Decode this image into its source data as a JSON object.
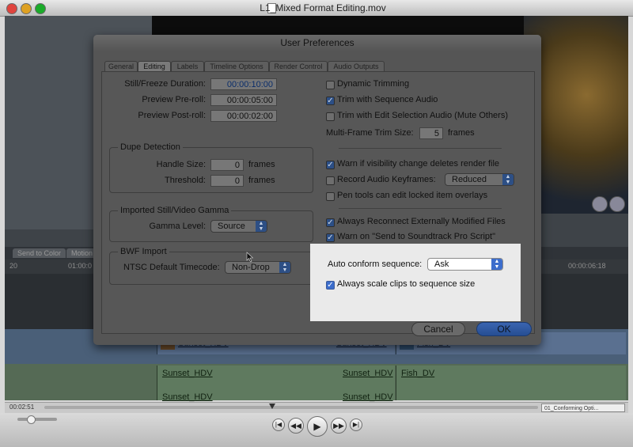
{
  "window": {
    "title": "L1_Mixed Format Editing.mov"
  },
  "colors": {
    "ok_blue": "#2c57a4",
    "highlight": "#eaeaea",
    "accent": "#3c6dcc"
  },
  "background_app": {
    "tabs": [
      "Send to Color",
      "Motion"
    ],
    "ruler_timecodes": [
      "20",
      "01:00:0",
      "00:00:06:18"
    ],
    "video_clips": [
      "Sunset_HDV",
      "Sunset_HDV",
      "Fish_DV"
    ],
    "audio_clips": [
      "Sunset_HDV",
      "Sunset_HDV",
      "Fish_DV",
      "Sunset_HDV",
      "Sunset_HDV"
    ]
  },
  "dialog": {
    "title": "User Preferences",
    "tabs": [
      "General",
      "Editing",
      "Labels",
      "Timeline Options",
      "Render Control",
      "Audio Outputs"
    ],
    "active_tab": "Editing",
    "left": {
      "still_freeze_label": "Still/Freeze Duration:",
      "still_freeze_value": "00:00:10:00",
      "preroll_label": "Preview Pre-roll:",
      "preroll_value": "00:00:05:00",
      "postroll_label": "Preview Post-roll:",
      "postroll_value": "00:00:02:00",
      "dupe": {
        "legend": "Dupe Detection",
        "handle_label": "Handle Size:",
        "handle_value": "0",
        "handle_unit": "frames",
        "threshold_label": "Threshold:",
        "threshold_value": "0",
        "threshold_unit": "frames"
      },
      "gamma": {
        "legend": "Imported Still/Video Gamma",
        "level_label": "Gamma Level:",
        "level_value": "Source"
      },
      "bwf": {
        "legend": "BWF Import",
        "ntsc_label": "NTSC Default Timecode:",
        "ntsc_value": "Non-Drop"
      }
    },
    "right": {
      "dynamic_trimming": {
        "label": "Dynamic Trimming",
        "checked": false
      },
      "trim_seq_audio": {
        "label": "Trim with Sequence Audio",
        "checked": true
      },
      "trim_edit_sel": {
        "label": "Trim with Edit Selection Audio (Mute Others)",
        "checked": false
      },
      "multiframe_label": "Multi-Frame Trim Size:",
      "multiframe_value": "5",
      "multiframe_unit": "frames",
      "warn_visibility": {
        "label": "Warn if visibility change deletes render file",
        "checked": true
      },
      "record_audio": {
        "label": "Record Audio Keyframes:",
        "checked": false,
        "value": "Reduced"
      },
      "pen_tools": {
        "label": "Pen tools can edit locked item overlays",
        "checked": false
      },
      "always_reconnect": {
        "label": "Always Reconnect Externally Modified Files",
        "checked": true
      },
      "warn_soundtrack": {
        "label": "Warn on \"Send to Soundtrack Pro Script\"",
        "checked": true
      },
      "auto_conform_label": "Auto conform sequence:",
      "auto_conform_value": "Ask",
      "always_scale": {
        "label": "Always scale clips to sequence size",
        "checked": true
      }
    },
    "cancel_label": "Cancel",
    "ok_label": "OK"
  },
  "player": {
    "timecode": "00:02:51",
    "chapter": "01_Conforming Opti..."
  }
}
